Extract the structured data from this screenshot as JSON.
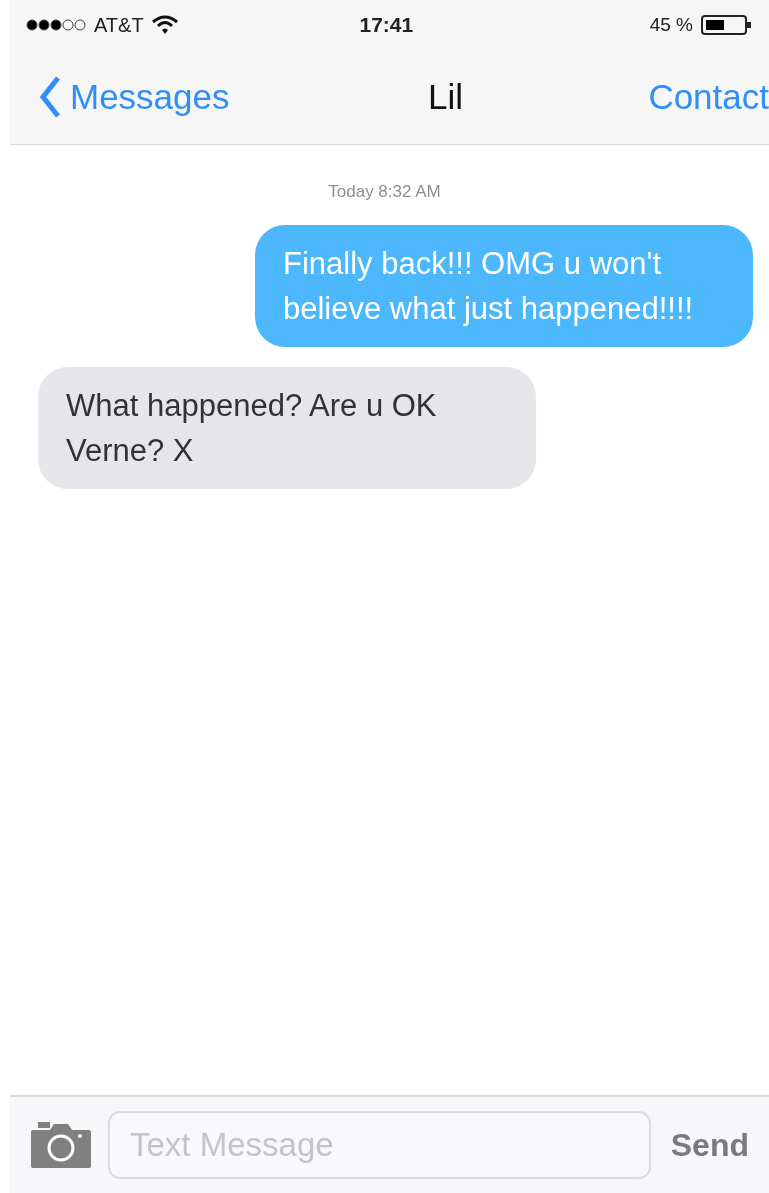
{
  "status_bar": {
    "carrier": "AT&T",
    "time": "17:41",
    "battery": "45 %"
  },
  "nav_bar": {
    "back": "Messages",
    "title": "Lil",
    "action": "Contact"
  },
  "timestamp": "Today 8:32 AM",
  "messages": [
    {
      "kind": "sent",
      "text": "Finally back!!! OMG u won't believe what just happened!!!!"
    },
    {
      "kind": "received",
      "text": "What happened? Are u OK Verne? X"
    }
  ],
  "composer": {
    "placeholder": "Text Message",
    "send": "Send"
  }
}
